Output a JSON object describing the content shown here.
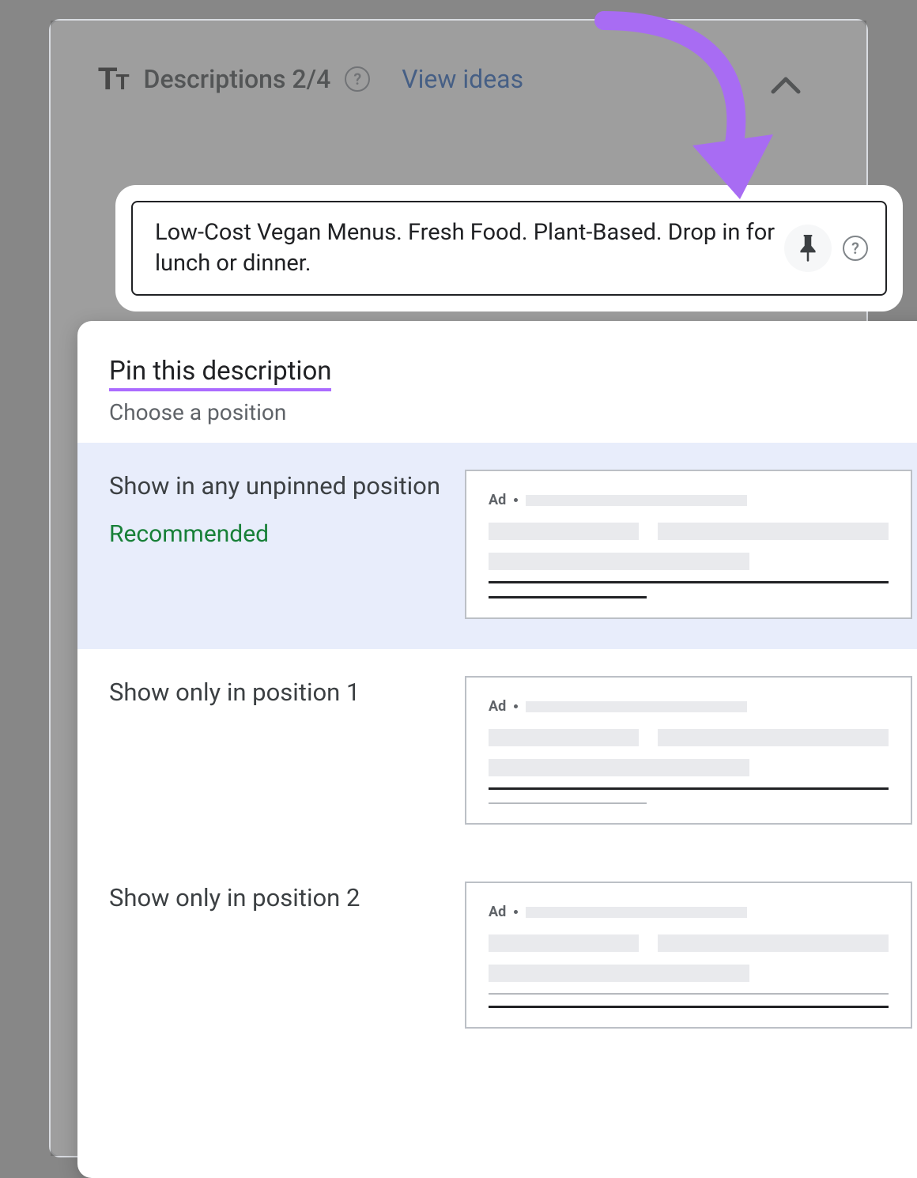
{
  "header": {
    "title": "Descriptions 2/4",
    "view_ideas": "View ideas"
  },
  "input": {
    "text": "Low-Cost Vegan Menus. Fresh Food. Plant-Based. Drop in for lunch or dinner."
  },
  "popover": {
    "title": "Pin this description",
    "subtitle": "Choose a position",
    "options": [
      {
        "label": "Show in any unpinned position",
        "recommended": "Recommended",
        "selected": true,
        "ad_label": "Ad",
        "variant": 0
      },
      {
        "label": "Show only in position 1",
        "recommended": "",
        "selected": false,
        "ad_label": "Ad",
        "variant": 1
      },
      {
        "label": "Show only in position 2",
        "recommended": "",
        "selected": false,
        "ad_label": "Ad",
        "variant": 2
      }
    ]
  }
}
